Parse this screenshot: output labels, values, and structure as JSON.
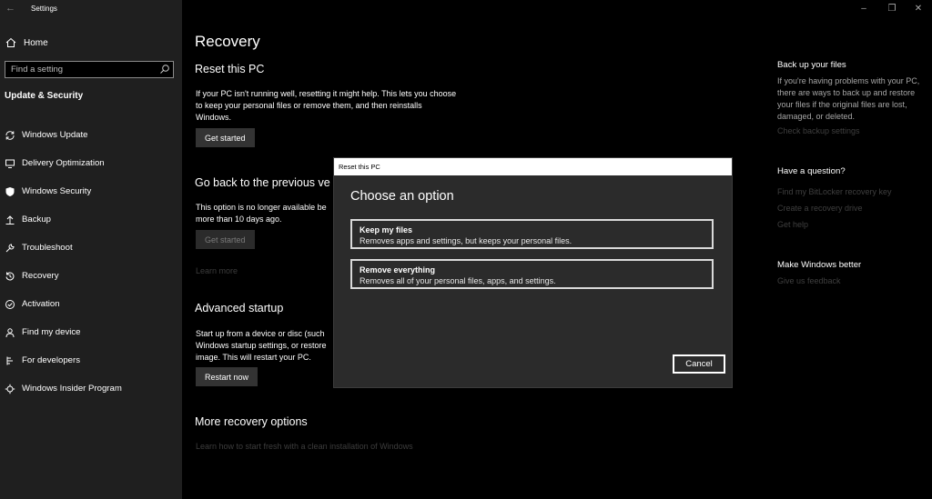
{
  "window": {
    "title": "Settings",
    "back_icon": "back-arrow-icon"
  },
  "sidebar": {
    "home_label": "Home",
    "search_placeholder": "Find a setting",
    "section_title": "Update & Security",
    "items": [
      {
        "label": "Windows Update",
        "icon": "sync-icon"
      },
      {
        "label": "Delivery Optimization",
        "icon": "delivery-icon"
      },
      {
        "label": "Windows Security",
        "icon": "shield-icon"
      },
      {
        "label": "Backup",
        "icon": "backup-arrow-icon"
      },
      {
        "label": "Troubleshoot",
        "icon": "wrench-icon"
      },
      {
        "label": "Recovery",
        "icon": "recovery-icon"
      },
      {
        "label": "Activation",
        "icon": "check-circle-icon"
      },
      {
        "label": "Find my device",
        "icon": "person-pin-icon"
      },
      {
        "label": "For developers",
        "icon": "developer-icon"
      },
      {
        "label": "Windows Insider Program",
        "icon": "insider-icon"
      }
    ]
  },
  "main": {
    "title": "Recovery",
    "reset": {
      "heading": "Reset this PC",
      "description": "If your PC isn't running well, resetting it might help. This lets you choose to keep your personal files or remove them, and then reinstalls Windows.",
      "button": "Get started"
    },
    "goback": {
      "heading": "Go back to the previous ve",
      "description": "This option is no longer available be more than 10 days ago.",
      "button": "Get started",
      "link": "Learn more"
    },
    "advanced": {
      "heading": "Advanced startup",
      "description": "Start up from a device or disc (such Windows startup settings, or restore image. This will restart your PC.",
      "button": "Restart now"
    },
    "more": {
      "heading": "More recovery options",
      "link": "Learn how to start fresh with a clean installation of Windows"
    }
  },
  "right": {
    "backup_heading": "Back up your files",
    "backup_text": "If you're having problems with your PC, there are ways to back up and restore your files if the original files are lost, damaged, or deleted.",
    "backup_link": "Check backup settings",
    "question_heading": "Have a question?",
    "links": [
      "Find my BitLocker recovery key",
      "Create a recovery drive",
      "Get help"
    ],
    "better_heading": "Make Windows better",
    "feedback_link": "Give us feedback"
  },
  "dialog": {
    "title": "Reset this PC",
    "heading": "Choose an option",
    "options": [
      {
        "title": "Keep my files",
        "desc": "Removes apps and settings, but keeps your personal files."
      },
      {
        "title": "Remove everything",
        "desc": "Removes all of your personal files, apps, and settings."
      }
    ],
    "cancel": "Cancel"
  },
  "colors": {
    "sidebar_bg": "#1f1f1f",
    "dialog_bg": "#2b2b2b",
    "button_bg": "#333333",
    "muted_link": "#3f3f3f"
  }
}
